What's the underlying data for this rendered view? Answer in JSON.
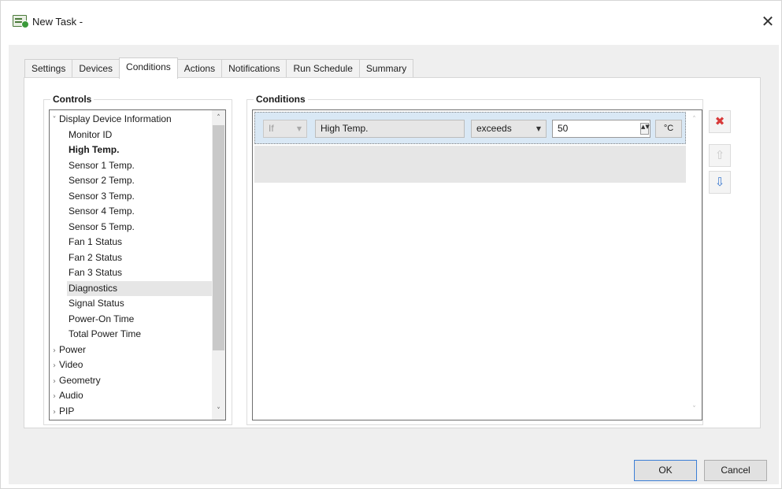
{
  "window": {
    "title": "New Task -",
    "close_glyph": "✕"
  },
  "tabs": [
    {
      "label": "Settings"
    },
    {
      "label": "Devices"
    },
    {
      "label": "Conditions"
    },
    {
      "label": "Actions"
    },
    {
      "label": "Notifications"
    },
    {
      "label": "Run Schedule"
    },
    {
      "label": "Summary"
    }
  ],
  "controls": {
    "group_label": "Controls",
    "tree": [
      {
        "label": "Display Device Information",
        "caret": "˅",
        "level": 0,
        "bold": false,
        "selected": false
      },
      {
        "label": "Monitor ID",
        "level": 1,
        "bold": false,
        "selected": false
      },
      {
        "label": "High Temp.",
        "level": 1,
        "bold": true,
        "selected": false
      },
      {
        "label": "Sensor 1 Temp.",
        "level": 1,
        "bold": false,
        "selected": false
      },
      {
        "label": "Sensor 2 Temp.",
        "level": 1,
        "bold": false,
        "selected": false
      },
      {
        "label": "Sensor 3 Temp.",
        "level": 1,
        "bold": false,
        "selected": false
      },
      {
        "label": "Sensor 4 Temp.",
        "level": 1,
        "bold": false,
        "selected": false
      },
      {
        "label": "Sensor 5 Temp.",
        "level": 1,
        "bold": false,
        "selected": false
      },
      {
        "label": "Fan 1 Status",
        "level": 1,
        "bold": false,
        "selected": false
      },
      {
        "label": "Fan 2 Status",
        "level": 1,
        "bold": false,
        "selected": false
      },
      {
        "label": "Fan 3 Status",
        "level": 1,
        "bold": false,
        "selected": false
      },
      {
        "label": "Diagnostics",
        "level": 1,
        "bold": false,
        "selected": true
      },
      {
        "label": "Signal Status",
        "level": 1,
        "bold": false,
        "selected": false
      },
      {
        "label": "Power-On Time",
        "level": 1,
        "bold": false,
        "selected": false
      },
      {
        "label": "Total Power Time",
        "level": 1,
        "bold": false,
        "selected": false
      },
      {
        "label": "Power",
        "caret": "›",
        "level": 0,
        "bold": false,
        "selected": false
      },
      {
        "label": "Video",
        "caret": "›",
        "level": 0,
        "bold": false,
        "selected": false
      },
      {
        "label": "Geometry",
        "caret": "›",
        "level": 0,
        "bold": false,
        "selected": false
      },
      {
        "label": "Audio",
        "caret": "›",
        "level": 0,
        "bold": false,
        "selected": false
      },
      {
        "label": "PIP",
        "caret": "›",
        "level": 0,
        "bold": false,
        "selected": false
      }
    ],
    "scroll_up": "˄",
    "scroll_down": "˅"
  },
  "conditions": {
    "group_label": "Conditions",
    "row": {
      "keyword": "If",
      "field": "High Temp.",
      "operator": "exceeds",
      "value": "50",
      "unit": "°C"
    },
    "dropdown_glyph": "▼",
    "spin_glyph": "▲▼",
    "scroll_up": "˄",
    "scroll_down": "˅"
  },
  "side_buttons": {
    "delete_glyph": "✖",
    "up_glyph": "⇧",
    "down_glyph": "⇩"
  },
  "footer": {
    "ok_label": "OK",
    "cancel_label": "Cancel"
  },
  "colors": {
    "selected_row": "#d9e8f5",
    "delete_red": "#d83a3a",
    "move_down_blue": "#3d7ad0",
    "ok_border": "#3c7fd6"
  }
}
